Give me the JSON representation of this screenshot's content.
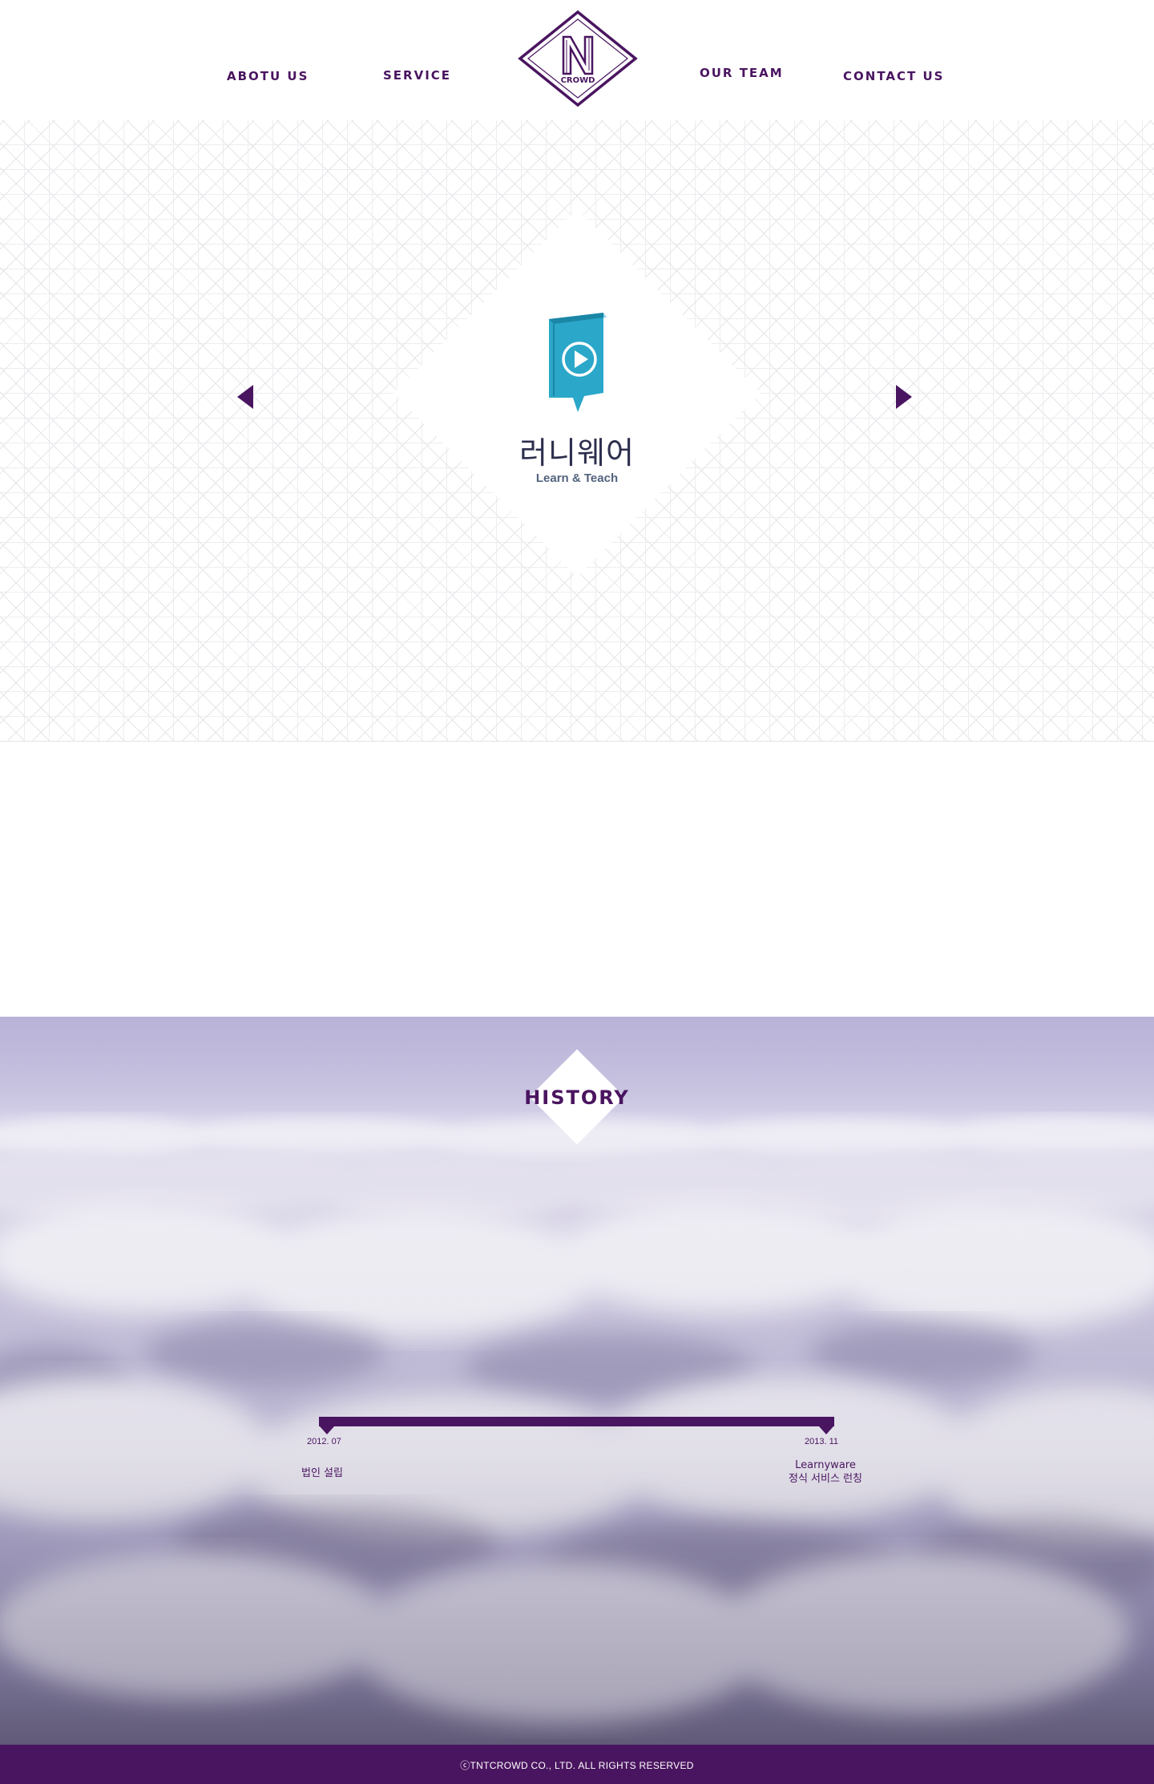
{
  "nav": {
    "items": [
      {
        "label": "ABOTU US"
      },
      {
        "label": "SERVICE"
      },
      {
        "label": "OUR TEAM"
      },
      {
        "label": "CONTACT US"
      }
    ],
    "logo_text": "CROWD",
    "logo_letter": "N"
  },
  "hero": {
    "service_title": "러니웨어",
    "service_subtitle": "Learn & Teach",
    "book_color": "#2aa7c9"
  },
  "history": {
    "title": "HISTORY",
    "events": [
      {
        "date": "2012. 07",
        "lines": [
          "법인 설립"
        ]
      },
      {
        "date": "2013. 11",
        "lines": [
          "Learnyware",
          "정식 서비스 런칭"
        ]
      }
    ]
  },
  "footer": {
    "copyright": "ⓒTNTCROWD CO., LTD. ALL RIGHTS RESERVED"
  },
  "colors": {
    "brand": "#4a1560",
    "accent": "#2aa7c9"
  }
}
